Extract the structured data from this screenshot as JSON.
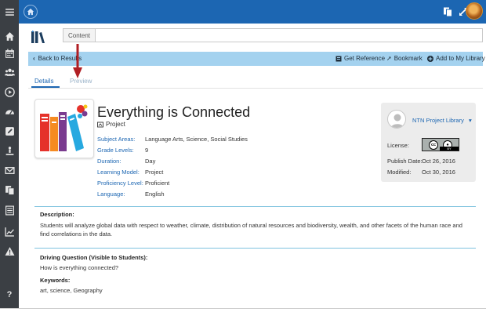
{
  "sidebar": {
    "items": [
      {
        "icon": "hamburger-icon"
      },
      {
        "icon": "home-icon"
      },
      {
        "icon": "calendar-icon"
      },
      {
        "icon": "users-icon"
      },
      {
        "icon": "play-icon"
      },
      {
        "icon": "dashboard-icon"
      },
      {
        "icon": "edit-icon"
      },
      {
        "icon": "person-download-icon"
      },
      {
        "icon": "mail-icon"
      },
      {
        "icon": "copy-icon"
      },
      {
        "icon": "list-icon"
      },
      {
        "icon": "chart-icon"
      },
      {
        "icon": "warning-icon"
      }
    ],
    "help_label": "?"
  },
  "search": {
    "content_label": "Content",
    "input_value": ""
  },
  "actionbar": {
    "back_label": "Back to Results",
    "get_reference_label": "Get Reference",
    "bookmark_label": "Bookmark",
    "add_library_label": "Add to My Library"
  },
  "tabs": {
    "details": "Details",
    "preview": "Preview"
  },
  "resource": {
    "title": "Everything is Connected",
    "type": "Project",
    "meta": [
      {
        "key": "Subject Areas:",
        "value": "Language Arts, Science, Social Studies"
      },
      {
        "key": "Grade Levels:",
        "value": "9"
      },
      {
        "key": "Duration:",
        "value": "Day"
      },
      {
        "key": "Learning Model:",
        "value": "Project"
      },
      {
        "key": "Proficiency Level:",
        "value": "Proficient"
      },
      {
        "key": "Language:",
        "value": "English"
      }
    ]
  },
  "author_card": {
    "name": "NTN Project Library",
    "license_label": "License:",
    "cc_label": "cc",
    "by_label": "BY",
    "publish_label": "Publish Date:",
    "publish_value": "Oct 26, 2016",
    "modified_label": "Modified:",
    "modified_value": "Oct 30, 2016"
  },
  "description": {
    "heading": "Description:",
    "text": "Students will analyze global data with respect to weather, climate, distribution of natural resources and biodiversity, wealth, and other facets of the human race and find correlations in the data."
  },
  "driving_question": {
    "heading": "Driving Question (Visible to Students):",
    "text": "How is everything connected?"
  },
  "keywords": {
    "heading": "Keywords:",
    "text": "art, science, Geography"
  },
  "colors": {
    "topbar": "#1c66b2",
    "sidebar": "#3b3f44",
    "actionbar": "#a4d2ef",
    "link": "#1c66b2",
    "arrow": "#b01f24"
  }
}
